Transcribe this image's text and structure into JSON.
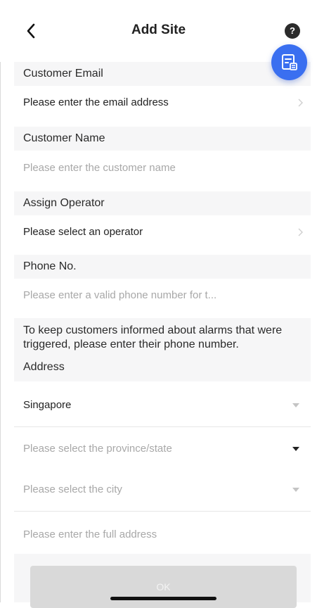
{
  "header": {
    "title": "Add Site",
    "help_glyph": "?",
    "back_icon": "chevron-left-icon",
    "fab_icon": "document-list-icon",
    "fab_color": "#3a6ff0"
  },
  "form": {
    "customer_email": {
      "label": "Customer Email",
      "value": "Please enter the email address"
    },
    "customer_name": {
      "label": "Customer Name",
      "placeholder": "Please enter the customer name"
    },
    "assign_operator": {
      "label": "Assign Operator",
      "value": "Please select an operator"
    },
    "phone": {
      "label": "Phone No.",
      "placeholder": "Please enter a valid phone number for t...",
      "note": "To keep customers informed about alarms that were triggered, please enter their phone number."
    },
    "address": {
      "label": "Address",
      "country": "Singapore",
      "province_placeholder": "Please select the province/state",
      "city_placeholder": "Please select the city",
      "full_address_placeholder": "Please enter the full address"
    }
  },
  "ok_button": {
    "label": "OK",
    "state": "disabled"
  }
}
